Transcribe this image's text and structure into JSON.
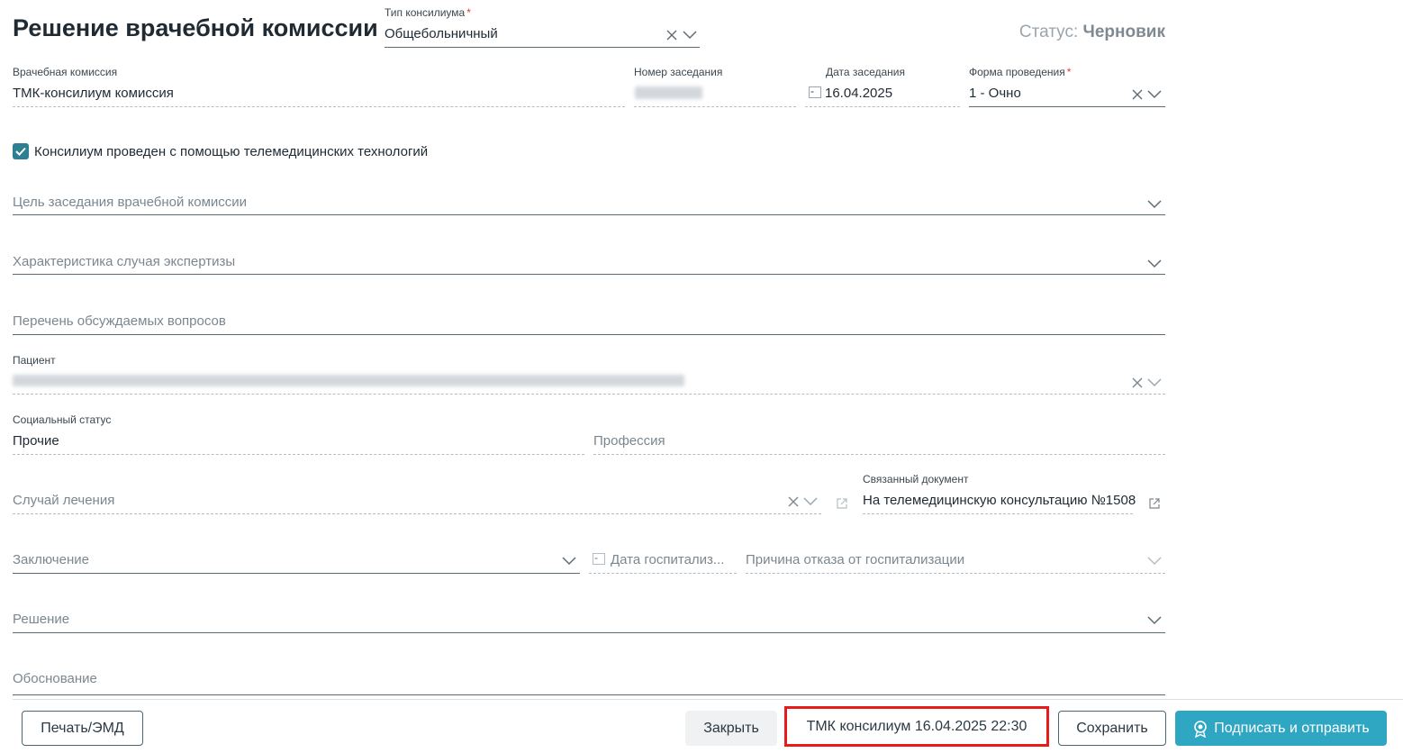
{
  "header": {
    "title": "Решение врачебной комиссии",
    "status_label": "Статус:",
    "status_value": "Черновик"
  },
  "consilium_type": {
    "label": "Тип консилиума",
    "value": "Общебольничный"
  },
  "commission": {
    "label": "Врачебная комиссия",
    "value": "ТМК-консилиум комиссия"
  },
  "session_number": {
    "label": "Номер заседания"
  },
  "session_date": {
    "label": "Дата заседания",
    "value": "16.04.2025"
  },
  "form": {
    "label": "Форма проведения",
    "value": "1 - Очно"
  },
  "telemed": {
    "checked": true,
    "label": "Консилиум проведен с помощью телемедицинских технологий"
  },
  "fields": {
    "goal": "Цель заседания врачебной комиссии",
    "characteristic": "Характеристика случая экспертизы",
    "questions": "Перечень обсуждаемых вопросов",
    "patient_label": "Пациент",
    "social_status_label": "Социальный статус",
    "social_status_value": "Прочие",
    "profession": "Профессия",
    "treatment_case": "Случай лечения",
    "linked_doc_label": "Связанный документ",
    "linked_doc_value": "На телемедицинскую консультацию №1508",
    "conclusion": "Заключение",
    "hosp_date": "Дата госпитализ...",
    "refusal_reason": "Причина отказа от госпитализации",
    "decision": "Решение",
    "justification": "Обоснование"
  },
  "footer": {
    "print_button": "Печать/ЭМД",
    "close_button": "Закрыть",
    "toast": "ТМК консилиум 16.04.2025 22:30",
    "save_button": "Сохранить",
    "sign_button": "Подписать и отправить"
  },
  "colors": {
    "accent": "#2fa7c3",
    "checkbox": "#2d7f92",
    "toast_border": "#e81a1a",
    "required": "#e53935"
  }
}
